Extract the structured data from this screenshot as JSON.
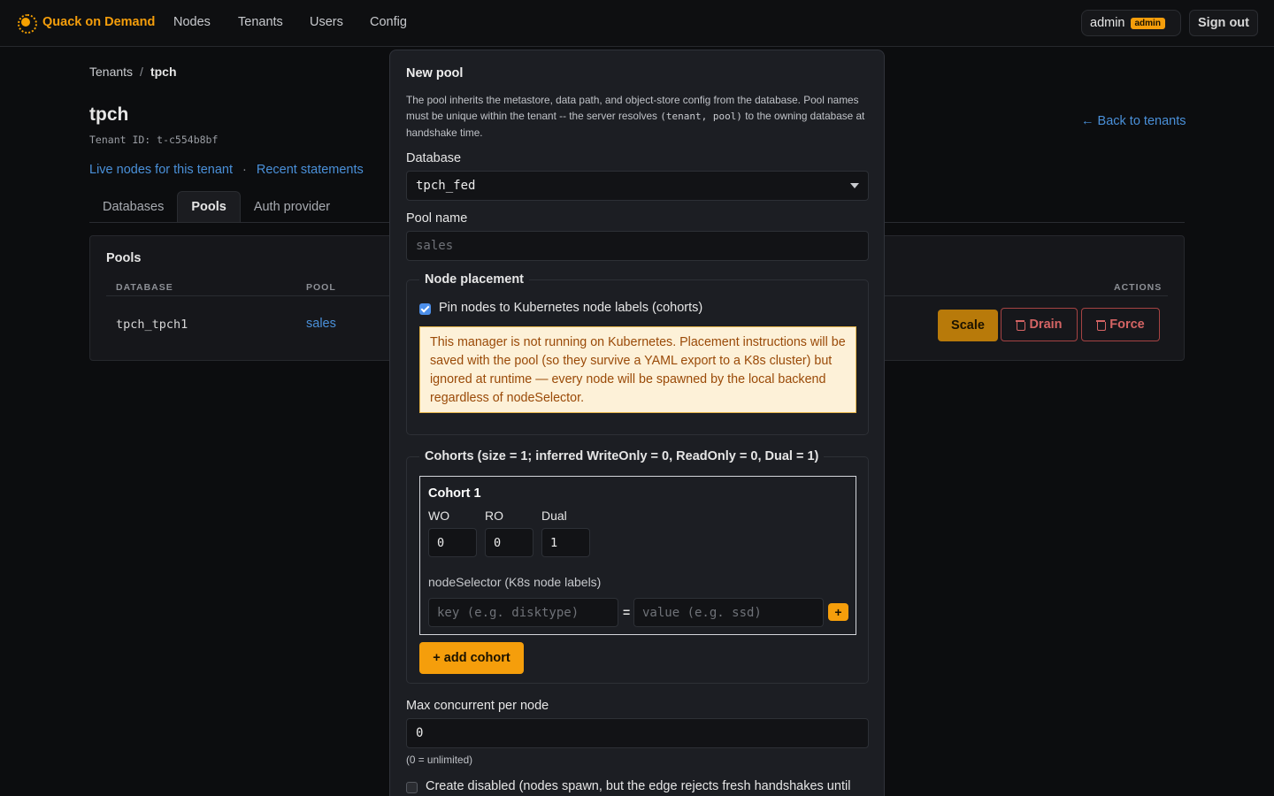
{
  "nav": {
    "brand": "Quack on Demand",
    "links": [
      "Nodes",
      "Tenants",
      "Users",
      "Config"
    ],
    "user": "admin",
    "role_badge": "admin",
    "sign_out": "Sign out"
  },
  "page": {
    "breadcrumb": {
      "parent": "Tenants",
      "separator": "/",
      "current": "tpch"
    },
    "title": "tpch",
    "tenant_id": "Tenant ID: t-c554b8bf",
    "back_link": "← Back to tenants",
    "links": {
      "live_nodes": "Live nodes for this tenant",
      "separator": "·",
      "recent": "Recent statements"
    },
    "tabs": [
      "Databases",
      "Pools",
      "Auth provider"
    ],
    "active_tab": "Pools"
  },
  "pools_card": {
    "title": "Pools",
    "columns": {
      "database": "DATABASE",
      "pool": "POOL",
      "actions": "ACTIONS"
    },
    "rows": [
      {
        "database": "tpch_tpch1",
        "pool": "sales"
      }
    ],
    "actions": {
      "scale": "Scale",
      "drain": "Drain",
      "force": "Force"
    }
  },
  "modal": {
    "title": "New pool",
    "description": {
      "part1": "The pool inherits the metastore, data path, and object-store config from the database. Pool names must be unique within the tenant -- the server resolves ",
      "code": "(tenant, pool)",
      "part2": " to the owning database at handshake time."
    },
    "database_label": "Database",
    "database_value": "tpch_fed",
    "pool_name_label": "Pool name",
    "pool_name_placeholder": "sales",
    "placement": {
      "legend": "Node placement",
      "pin_label": "Pin nodes to Kubernetes node labels (cohorts)",
      "pin_checked": true,
      "warning": "This manager is not running on Kubernetes. Placement instructions will be saved with the pool (so they survive a YAML export to a K8s cluster) but ignored at runtime — every node will be spawned by the local backend regardless of nodeSelector."
    },
    "cohorts": {
      "legend": "Cohorts (size = 1; inferred WriteOnly = 0, ReadOnly = 0, Dual = 1)",
      "cohort_title": "Cohort 1",
      "wo_label": "WO",
      "ro_label": "RO",
      "dual_label": "Dual",
      "wo_value": "0",
      "ro_value": "0",
      "dual_value": "1",
      "node_selector_label": "nodeSelector (K8s node labels)",
      "key_placeholder": "key (e.g. disktype)",
      "equals": "=",
      "value_placeholder": "value (e.g. ssd)",
      "plus": "+",
      "add_cohort": "+ add cohort"
    },
    "max_concurrent_label": "Max concurrent per node",
    "max_concurrent_value": "0",
    "max_concurrent_hint": "(0 = unlimited)",
    "create_disabled_label": "Create disabled (nodes spawn, but the edge rejects fresh handshakes until",
    "create_disabled_checked": false
  },
  "colors": {
    "accent": "#f59e0b",
    "link": "#4a90d9",
    "danger": "#d46464",
    "warning_bg": "#fdf1d8",
    "warning_text": "#9a4a08"
  }
}
